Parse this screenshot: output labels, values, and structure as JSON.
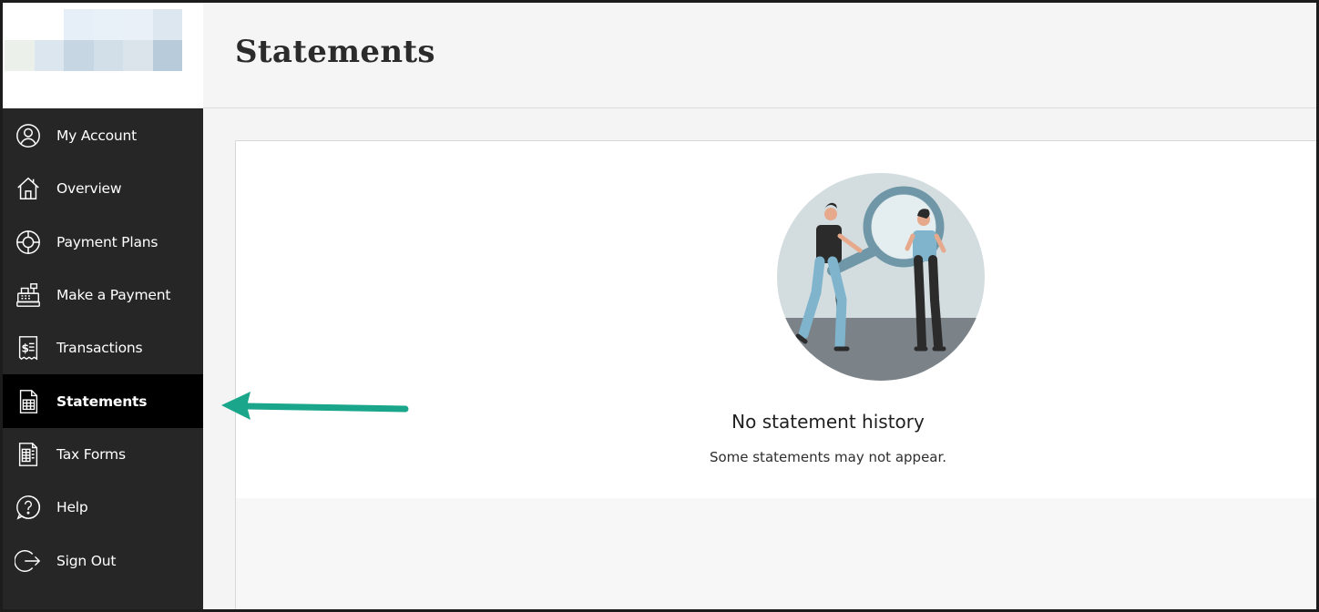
{
  "sidebar": {
    "items": [
      {
        "label": "My Account",
        "icon": "user-circle-icon"
      },
      {
        "label": "Overview",
        "icon": "home-icon"
      },
      {
        "label": "Payment Plans",
        "icon": "lifebuoy-icon"
      },
      {
        "label": "Make a Payment",
        "icon": "cash-register-icon"
      },
      {
        "label": "Transactions",
        "icon": "receipt-dollar-icon"
      },
      {
        "label": "Statements",
        "icon": "document-table-icon",
        "active": true
      },
      {
        "label": "Tax Forms",
        "icon": "tax-form-icon"
      },
      {
        "label": "Help",
        "icon": "help-circle-icon"
      },
      {
        "label": "Sign Out",
        "icon": "sign-out-icon"
      }
    ]
  },
  "header": {
    "title": "Statements"
  },
  "empty_state": {
    "title": "No statement history",
    "subtitle": "Some statements may not appear.",
    "illustration": "people-magnifying-glass-illustration"
  },
  "colors": {
    "sidebar_bg": "#262626",
    "active_item_bg": "#000000",
    "arrow": "#1aa68a",
    "illustration_circle": "#d3dde0",
    "illustration_floor": "#7b8288"
  }
}
